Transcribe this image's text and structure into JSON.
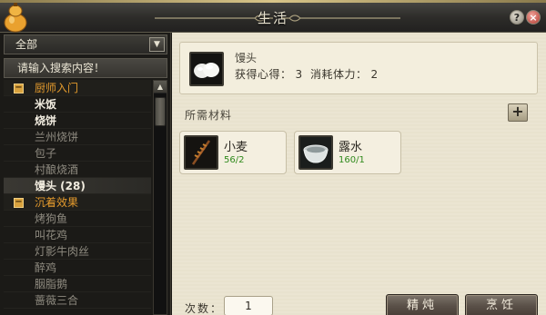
{
  "window": {
    "title": "生活"
  },
  "controls": {
    "help": "?",
    "close": "×"
  },
  "left": {
    "dropdown_value": "全部",
    "search_placeholder": "请输入搜索内容！",
    "rows": [
      {
        "label": "厨师入门",
        "type": "cat"
      },
      {
        "label": "米饭",
        "type": "white"
      },
      {
        "label": "烧饼",
        "type": "white"
      },
      {
        "label": "兰州烧饼",
        "type": "grey"
      },
      {
        "label": "包子",
        "type": "grey"
      },
      {
        "label": "村酿烧酒",
        "type": "grey"
      },
      {
        "label": "馒头 (28)",
        "type": "sel"
      },
      {
        "label": "沉着效果",
        "type": "cat"
      },
      {
        "label": "烤狗鱼",
        "type": "grey"
      },
      {
        "label": "叫花鸡",
        "type": "grey"
      },
      {
        "label": "灯影牛肉丝",
        "type": "grey"
      },
      {
        "label": "醉鸡",
        "type": "grey"
      },
      {
        "label": "胭脂鹅",
        "type": "grey"
      },
      {
        "label": "蔷薇三合",
        "type": "grey"
      }
    ]
  },
  "product": {
    "name": "馒头",
    "gain_label": "获得心得：",
    "gain_value": "3",
    "cost_label": "消耗体力：",
    "cost_value": "2"
  },
  "materials": {
    "header": "所需材料",
    "add_label": "+",
    "items": [
      {
        "name": "小麦",
        "count": "56/2",
        "icon": "wheat-icon"
      },
      {
        "name": "露水",
        "count": "160/1",
        "icon": "bowl-icon"
      }
    ]
  },
  "footer": {
    "times_label": "次数：",
    "times_value": "1",
    "refine_button": "精炖",
    "cook_button": "烹饪"
  },
  "colors": {
    "category": "#e39a2d",
    "count_green": "#2f8a1c",
    "panel_bg": "#ebe5d2"
  }
}
